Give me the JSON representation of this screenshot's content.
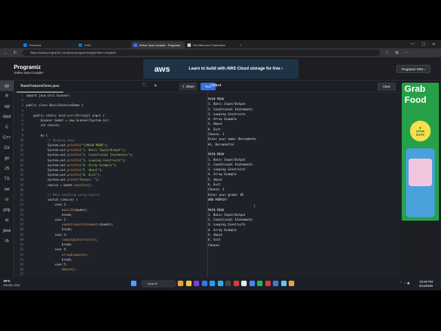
{
  "browser": {
    "tabs": [
      {
        "label": "Facebook",
        "color": "#1877f2",
        "active": false
      },
      {
        "label": "Trello",
        "color": "#0079bf",
        "active": false
      },
      {
        "label": "Online Java Compiler - Programiz",
        "color": "#4c6ef5",
        "active": true
      },
      {
        "label": "Set Difference Explanation",
        "color": "#cccccc",
        "active": false
      }
    ],
    "url": "https://www.programiz.com/java-programming/online-compiler/"
  },
  "header": {
    "logo": "Programiz",
    "subtitle": "Online Java Compiler",
    "ad_brand": "aws",
    "ad_text": "Learn to build with AWS Cloud storage for free ›",
    "pro_button": "Programiz PRO ›"
  },
  "toolbar": {
    "file_tab": "BasicFeaturesDemo.java",
    "share_label": "Share",
    "run_label": "Run",
    "output_label": "Output",
    "clear_label": "Clear"
  },
  "sidebar": {
    "items": [
      "py",
      "R",
      "sql",
      "html",
      "C",
      "C++",
      "C#",
      "go",
      "JS",
      "TS",
      "sw",
      "rs",
      "php",
      "kt",
      "java",
      "rb"
    ]
  },
  "editor": {
    "line_numbers": [
      "1",
      "2",
      "3",
      "4",
      "5",
      "6",
      "7",
      "8",
      "9",
      "10",
      "11",
      "12",
      "13",
      "14",
      "15",
      "16",
      "17",
      "18",
      "19",
      "20",
      "21",
      "22",
      "23",
      "24",
      "25",
      "26",
      "27",
      "28",
      "29",
      "30",
      "31",
      "32",
      "33",
      "34",
      "35",
      "36",
      "37"
    ],
    "lines": [
      "import java.util.Scanner;",
      "",
      "public class BasicFeaturesDemo {",
      "",
      "    public static void main(String[] args) {",
      "        Scanner badet = new Scanner(System.in);",
      "        int choice;",
      "",
      "        do {",
      "            // Display menu",
      "            System.out.println(\"\\nMAIN MENU\");",
      "            System.out.println(\"1. Basic Input/Output\");",
      "            System.out.println(\"2. Conditional Statements\");",
      "            System.out.println(\"3. Looping Constructs\");",
      "            System.out.println(\"4. Array Example\");",
      "            System.out.println(\"5. About\");",
      "            System.out.println(\"6. Exit\");",
      "            System.out.print(\"Choose: \");",
      "            choice = badet.nextInt();",
      "",
      "            // Menu handling using switch",
      "            switch (choice) {",
      "                case 1:",
      "                    basicIO(badet);",
      "                    break;",
      "                case 2:",
      "                    conditionalStatements(badet);",
      "                    break;",
      "                case 3:",
      "                    loopingConstructs();",
      "                    break;",
      "                case 4:",
      "                    arrayExample();",
      "                    break;",
      "                case 5:",
      "                    about();",
      ""
    ]
  },
  "output": {
    "lines": [
      "MAIN MENU",
      "1. Basic Input/Output",
      "2. Conditional Statements",
      "3. Looping Constructs",
      "4. Array Example",
      "5. About",
      "6. Exit",
      "Choose: 1",
      "Enter your name: Bernadette",
      "Hi, Bernadette!",
      "",
      "MAIN MENU",
      "1. Basic Input/Output",
      "2. Conditional Statements",
      "3. Looping Constructs",
      "4. Array Example",
      "5. About",
      "6. Exit",
      "Choose: 2",
      "Enter your grade: 85",
      "WOW PUMASA!",
      "",
      "MAIN MENU",
      "1. Basic Input/Output",
      "2. Conditional Statements",
      "3. Looping Constructs",
      "4. Array Example",
      "5. About",
      "6. Exit",
      "Choose:"
    ]
  },
  "ad_side": {
    "title_line1": "Grab",
    "title_line2": "Food",
    "badge_line1": "5",
    "badge_line2": "STAR",
    "badge_line3": "EATS"
  },
  "taskbar": {
    "weather_temp": "30°C",
    "weather_desc": "Mostly clear",
    "search_label": "Search",
    "time": "10:26 PM",
    "date": "3/14/2025"
  }
}
